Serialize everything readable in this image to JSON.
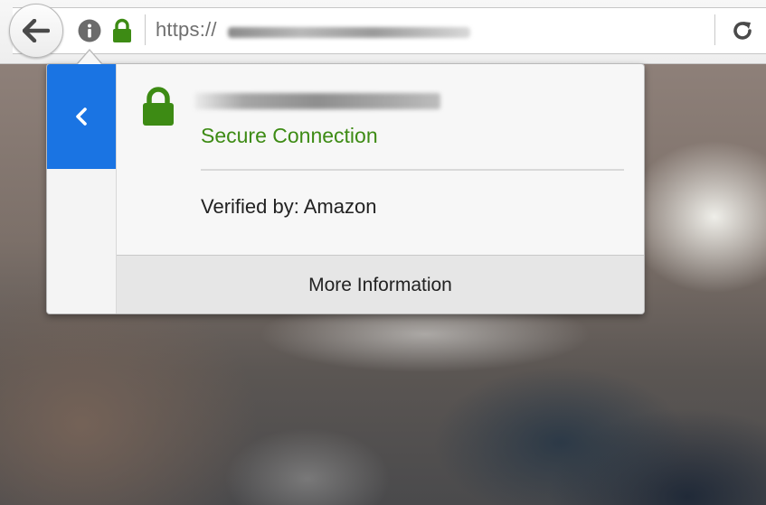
{
  "toolbar": {
    "url_prefix": "https://",
    "back_icon": "arrow-left-icon",
    "info_icon": "info-icon",
    "lock_icon": "lock-icon",
    "reload_icon": "reload-icon",
    "lock_color": "#3d8b14"
  },
  "identity_popup": {
    "secure_label": "Secure Connection",
    "verified_by": "Verified by: Amazon",
    "more_info_label": "More Information",
    "back_icon": "chevron-left-icon",
    "accent_color": "#1a74e3",
    "secure_color": "#3d8b14"
  }
}
